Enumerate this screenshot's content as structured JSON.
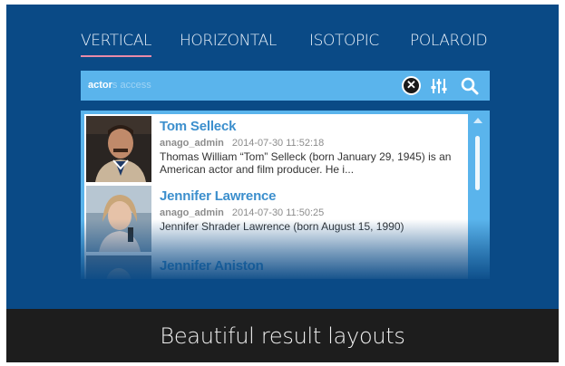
{
  "tabs": [
    {
      "label": "VERTICAL",
      "active": true
    },
    {
      "label": "HORIZONTAL",
      "active": false
    },
    {
      "label": "ISOTOPIC",
      "active": false
    },
    {
      "label": "POLAROID",
      "active": false
    }
  ],
  "search": {
    "typed": "actor",
    "suggestion": "s access",
    "clear_icon": "close-icon",
    "filter_icon": "filter-sliders-icon",
    "search_icon": "search-icon"
  },
  "results": [
    {
      "title": "Tom Selleck",
      "author": "anago_admin",
      "date": "2014-07-30 11:52:18",
      "description": "Thomas William “Tom” Selleck (born January 29, 1945) is an American actor and film producer. He i..."
    },
    {
      "title": "Jennifer Lawrence",
      "author": "anago_admin",
      "date": "2014-07-30 11:50:25",
      "description": "Jennifer Shrader Lawrence (born August 15, 1990)"
    },
    {
      "title": "Jennifer Aniston",
      "author": "",
      "date": "",
      "description": ""
    }
  ],
  "caption": "Beautiful result layouts",
  "colors": {
    "background": "#0a4a86",
    "search_bar": "#5ab4ec",
    "tab_underline": "#e88aa8",
    "result_title": "#3c8fcd",
    "caption_bar": "#1d1d1d"
  }
}
